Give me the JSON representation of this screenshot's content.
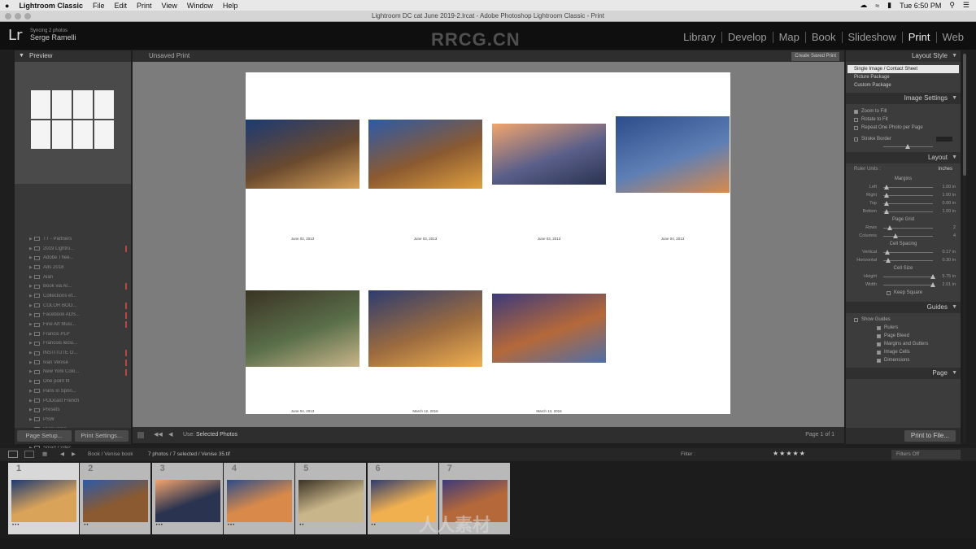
{
  "menubar": {
    "apple": "",
    "app_name": "Lightroom Classic",
    "items": [
      "File",
      "Edit",
      "Print",
      "View",
      "Window",
      "Help"
    ],
    "clock": "Tue 6:50 PM"
  },
  "window_title": "Lightroom DC cat June 2019-2.lrcat - Adobe Photoshop Lightroom Classic - Print",
  "identity": {
    "logo": "Lr",
    "line1": "Syncing 2 photos",
    "name": "Serge Ramelli"
  },
  "watermark_top": "RRCG.CN",
  "modules": [
    "Library",
    "Develop",
    "Map",
    "Book",
    "Slideshow",
    "Print",
    "Web"
  ],
  "active_module": "Print",
  "left_panel": {
    "preview_title": "Preview",
    "collections": [
      {
        "label": "TT - Partners",
        "mark": false
      },
      {
        "label": "2019 Lightro...",
        "mark": true
      },
      {
        "label": "Adobe Thee...",
        "mark": false
      },
      {
        "label": "Ads 2018",
        "mark": false
      },
      {
        "label": "Alan",
        "mark": false
      },
      {
        "label": "Book via Ar...",
        "mark": true
      },
      {
        "label": "Collections ef...",
        "mark": false
      },
      {
        "label": "COLOR BOO...",
        "mark": true
      },
      {
        "label": "Facebook ADS...",
        "mark": true
      },
      {
        "label": "Fine Art Musi...",
        "mark": true
      },
      {
        "label": "Francis PLP",
        "mark": false
      },
      {
        "label": "Francois leclu...",
        "mark": false
      },
      {
        "label": "INSTITUTE O...",
        "mark": true
      },
      {
        "label": "Ivan Venise",
        "mark": true
      },
      {
        "label": "New York Colo...",
        "mark": true
      },
      {
        "label": "One point fit",
        "mark": false
      },
      {
        "label": "Paris in Sprin...",
        "mark": false
      },
      {
        "label": "PODcast French",
        "mark": false
      },
      {
        "label": "Presets",
        "mark": false
      },
      {
        "label": "PSW",
        "mark": false
      },
      {
        "label": "PSW 2019",
        "mark": false
      },
      {
        "label": "SEO",
        "mark": false
      },
      {
        "label": "Smart Collec...",
        "mark": false
      },
      {
        "label": "Temp",
        "mark": false
      },
      {
        "label": "Temp PLP",
        "mark": false
      },
      {
        "label": "Temp 2...",
        "mark": false
      }
    ],
    "page_setup_label": "Page Setup...",
    "print_settings_label": "Print Settings..."
  },
  "center": {
    "header_title": "Unsaved Print",
    "create_saved_print": "Create Saved Print",
    "use_label": "Use:",
    "use_value": "Selected Photos",
    "page_indicator": "Page 1 of 1",
    "photos": [
      {
        "caption": "June 02, 2013",
        "colors": [
          "#1b3a73",
          "#6b4a2e",
          "#d9a35a"
        ]
      },
      {
        "caption": "June 03, 2013",
        "colors": [
          "#2c5aa8",
          "#8b5a30",
          "#e0a040"
        ]
      },
      {
        "caption": "June 03, 2013",
        "colors": [
          "#f2a56d",
          "#5a5f8a",
          "#2a3350"
        ]
      },
      {
        "caption": "June 04, 2013",
        "colors": [
          "#2c4c8a",
          "#5e7fb5",
          "#d98a4a"
        ]
      },
      {
        "caption": "June 04, 2013",
        "colors": [
          "#3b3324",
          "#5a6f4a",
          "#c9b58a"
        ]
      },
      {
        "caption": "March 12, 2016",
        "colors": [
          "#2d3c6f",
          "#9b6b3f",
          "#f0b050"
        ]
      },
      {
        "caption": "March 13, 2016",
        "colors": [
          "#3d3a7a",
          "#b5693a",
          "#4f6fa8"
        ]
      }
    ]
  },
  "right_panel": {
    "layout_style_title": "Layout Style",
    "layout_styles": [
      {
        "label": "Single Image / Contact Sheet",
        "selected": true
      },
      {
        "label": "Picture Package",
        "selected": false
      },
      {
        "label": "Custom Package",
        "selected": false
      }
    ],
    "image_settings_title": "Image Settings",
    "image_settings": [
      {
        "label": "Zoom to Fill",
        "checked": true
      },
      {
        "label": "Rotate to Fit",
        "checked": false
      },
      {
        "label": "Repeat One Photo per Page",
        "checked": false
      }
    ],
    "stroke_border": "Stroke Border",
    "layout_title": "Layout",
    "ruler_units_label": "Ruler Units :",
    "ruler_units_value": "Inches",
    "margins_title": "Margins",
    "margins": [
      {
        "label": "Left",
        "value": "1.00 in",
        "pos": 0.02
      },
      {
        "label": "Right",
        "value": "1.00 in",
        "pos": 0.02
      },
      {
        "label": "Top",
        "value": "0.00 in",
        "pos": 0.02
      },
      {
        "label": "Bottom",
        "value": "1.00 in",
        "pos": 0.02
      }
    ],
    "page_grid_title": "Page Grid",
    "page_grid": [
      {
        "label": "Rows",
        "value": "2",
        "pos": 0.08
      },
      {
        "label": "Columns",
        "value": "4",
        "pos": 0.2
      }
    ],
    "cell_spacing_title": "Cell Spacing",
    "cell_spacing": [
      {
        "label": "Vertical",
        "value": "0.17 in",
        "pos": 0.03
      },
      {
        "label": "Horizontal",
        "value": "0.30 in",
        "pos": 0.05
      }
    ],
    "cell_size_title": "Cell Size",
    "cell_size": [
      {
        "label": "Height",
        "value": "5.75 in",
        "pos": 0.95
      },
      {
        "label": "Width",
        "value": "2.01 in",
        "pos": 0.95
      }
    ],
    "keep_square": "Keep Square",
    "guides_title": "Guides",
    "show_guides": "Show Guides",
    "guides": [
      "Rulers",
      "Page Bleed",
      "Margins and Gutters",
      "Image Cells",
      "Dimensions"
    ],
    "page_title": "Page",
    "print_to_file": "Print to File..."
  },
  "filmbar": {
    "source": "Book / Venise book",
    "count": "7 photos / 7 selected / Venise 35.tif",
    "filter_label": "Filter :",
    "filters_off": "Filters Off"
  },
  "filmstrip": [
    {
      "num": "1",
      "stars": "•••",
      "colors": [
        "#1b3a73",
        "#d9a35a"
      ],
      "selected": true
    },
    {
      "num": "2",
      "stars": "••",
      "colors": [
        "#2c5aa8",
        "#8b5a30"
      ],
      "selected": false
    },
    {
      "num": "3",
      "stars": "•••",
      "colors": [
        "#f2a56d",
        "#2a3350"
      ],
      "selected": false
    },
    {
      "num": "4",
      "stars": "•••",
      "colors": [
        "#2c4c8a",
        "#d98a4a"
      ],
      "selected": false
    },
    {
      "num": "5",
      "stars": "••",
      "colors": [
        "#3b3324",
        "#c9b58a"
      ],
      "selected": false
    },
    {
      "num": "6",
      "stars": "••",
      "colors": [
        "#2d3c6f",
        "#f0b050"
      ],
      "selected": false
    },
    {
      "num": "7",
      "stars": "",
      "colors": [
        "#3d3a7a",
        "#b5693a"
      ],
      "selected": false
    }
  ],
  "watermark_bottom": "人人素材"
}
